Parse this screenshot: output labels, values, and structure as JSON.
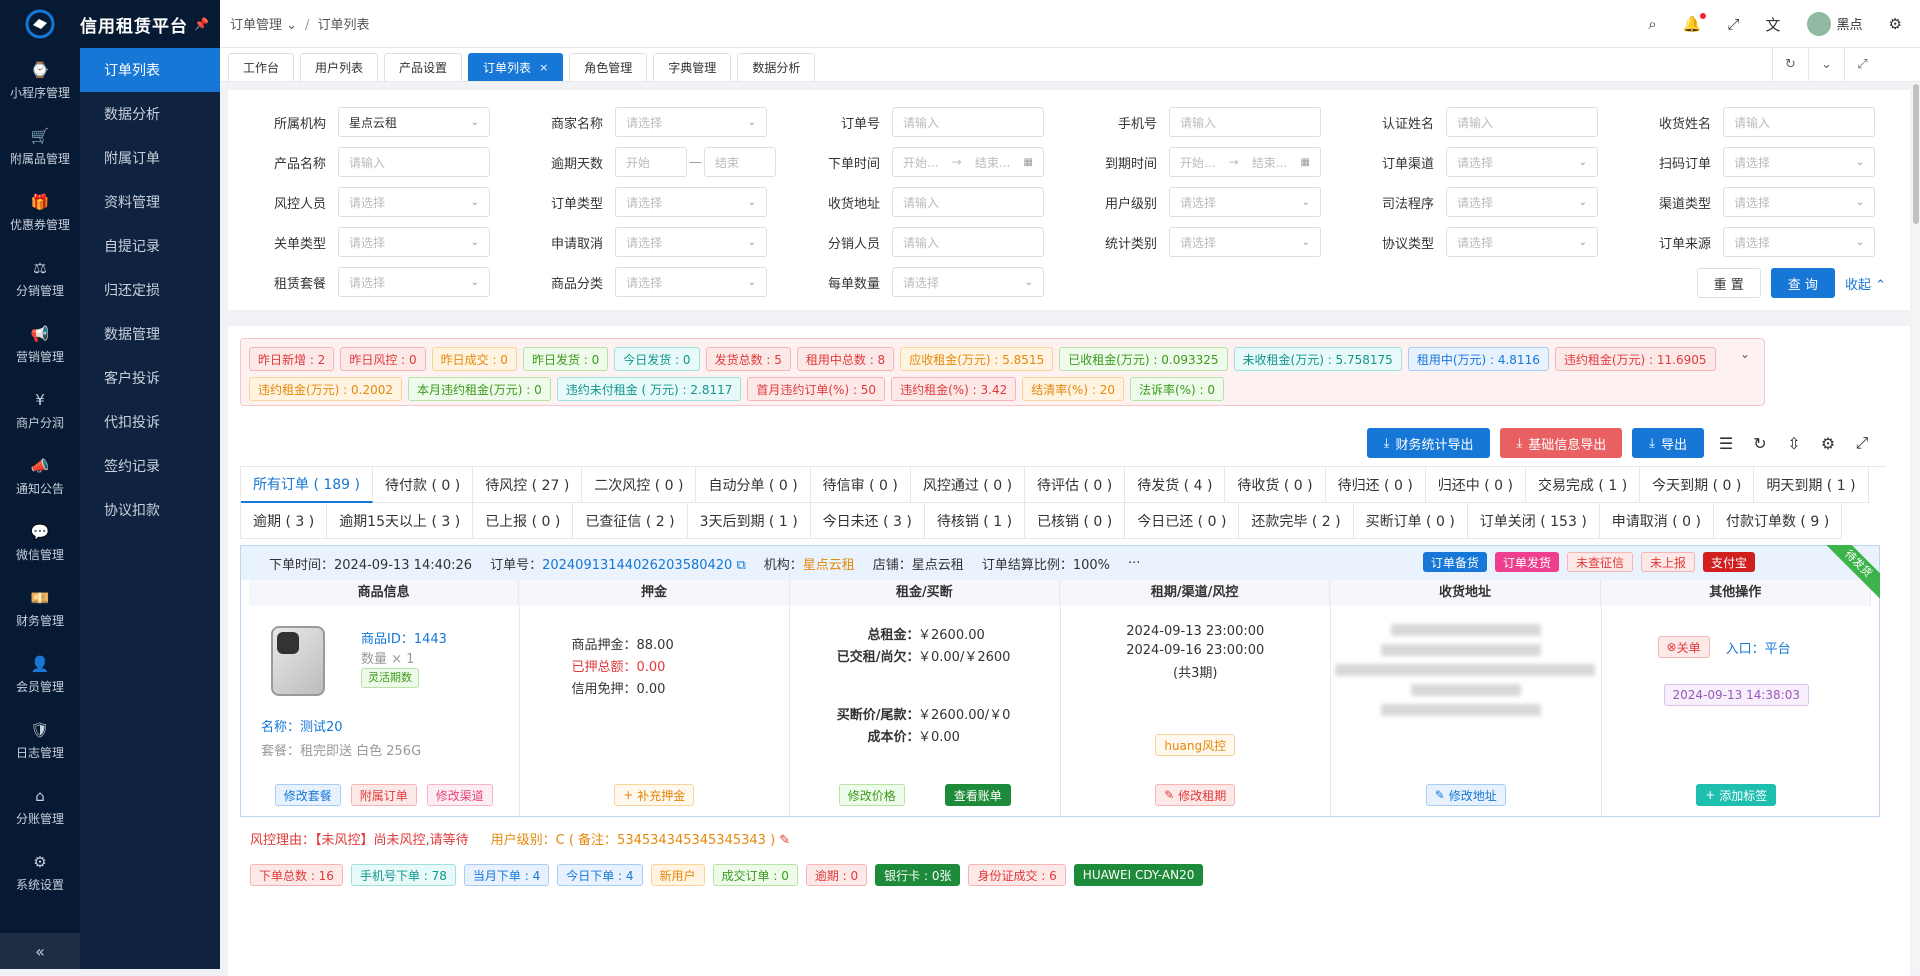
{
  "app": {
    "title": "信用租赁平台"
  },
  "rail": [
    {
      "label": "小程序管理",
      "icon": "watch-icon"
    },
    {
      "label": "附属品管理",
      "icon": "cart-icon"
    },
    {
      "label": "优惠券管理",
      "icon": "gift-icon"
    },
    {
      "label": "分销管理",
      "icon": "distribution-icon"
    },
    {
      "label": "营销管理",
      "icon": "megaphone-icon"
    },
    {
      "label": "商户分润",
      "icon": "yen-icon"
    },
    {
      "label": "通知公告",
      "icon": "notice-icon"
    },
    {
      "label": "微信管理",
      "icon": "chat-icon"
    },
    {
      "label": "财务管理",
      "icon": "finance-icon"
    },
    {
      "label": "会员管理",
      "icon": "member-icon"
    },
    {
      "label": "日志管理",
      "icon": "shield-icon"
    },
    {
      "label": "分账管理",
      "icon": "split-icon"
    },
    {
      "label": "系统设置",
      "icon": "gear-icon"
    }
  ],
  "submenu": [
    "订单列表",
    "数据分析",
    "附属订单",
    "资料管理",
    "自提记录",
    "归还定损",
    "数据管理",
    "客户投诉",
    "代扣投诉",
    "签约记录",
    "协议扣款"
  ],
  "breadcrumb": {
    "parent": "订单管理",
    "current": "订单列表"
  },
  "user": {
    "name": "黑点"
  },
  "tabs": [
    "工作台",
    "用户列表",
    "产品设置",
    "订单列表",
    "角色管理",
    "字典管理",
    "数据分析"
  ],
  "filters": {
    "row1": [
      {
        "label": "所属机构",
        "value": "星点云租",
        "type": "select"
      },
      {
        "label": "商家名称",
        "value": "请选择",
        "type": "select"
      },
      {
        "label": "订单号",
        "value": "请输入",
        "type": "input"
      },
      {
        "label": "手机号",
        "value": "请输入",
        "type": "input"
      },
      {
        "label": "认证姓名",
        "value": "请输入",
        "type": "input"
      },
      {
        "label": "收货姓名",
        "value": "请输入",
        "type": "input"
      }
    ],
    "row2_name": {
      "label": "产品名称",
      "value": "请输入"
    },
    "overdue": {
      "label": "逾期天数",
      "start": "开始",
      "end": "结束"
    },
    "order_time": {
      "label": "下单时间",
      "start": "开始...",
      "end": "结束..."
    },
    "due_time": {
      "label": "到期时间",
      "start": "开始...",
      "end": "结束..."
    },
    "row2_rest": [
      {
        "label": "订单渠道",
        "value": "请选择"
      },
      {
        "label": "扫码订单",
        "value": "请选择"
      }
    ],
    "row3": [
      {
        "label": "风控人员",
        "value": "请选择",
        "type": "select"
      },
      {
        "label": "订单类型",
        "value": "请选择",
        "type": "select"
      },
      {
        "label": "收货地址",
        "value": "请输入",
        "type": "input"
      },
      {
        "label": "用户级别",
        "value": "请选择",
        "type": "select"
      },
      {
        "label": "司法程序",
        "value": "请选择",
        "type": "select"
      },
      {
        "label": "渠道类型",
        "value": "请选择",
        "type": "select"
      }
    ],
    "row4": [
      {
        "label": "关单类型",
        "value": "请选择",
        "type": "select"
      },
      {
        "label": "申请取消",
        "value": "请选择",
        "type": "select"
      },
      {
        "label": "分销人员",
        "value": "请输入",
        "type": "input"
      },
      {
        "label": "统计类别",
        "value": "请选择",
        "type": "select"
      },
      {
        "label": "协议类型",
        "value": "请选择",
        "type": "select"
      },
      {
        "label": "订单来源",
        "value": "请选择",
        "type": "select"
      }
    ],
    "row5": [
      {
        "label": "租赁套餐",
        "value": "请选择",
        "type": "select"
      },
      {
        "label": "商品分类",
        "value": "请选择",
        "type": "select"
      },
      {
        "label": "每单数量",
        "value": "请选择",
        "type": "select"
      }
    ],
    "reset": "重 置",
    "query": "查 询",
    "collapse": "收起"
  },
  "stats": [
    {
      "text": "昨日新增 : 2",
      "c": "red"
    },
    {
      "text": "昨日风控 : 0",
      "c": "red"
    },
    {
      "text": "昨日成交 : 0",
      "c": "orange"
    },
    {
      "text": "昨日发货 : 0",
      "c": "green"
    },
    {
      "text": "今日发货 : 0",
      "c": "cyan"
    },
    {
      "text": "发货总数 : 5",
      "c": "red"
    },
    {
      "text": "租用中总数 : 8",
      "c": "red"
    },
    {
      "text": "应收租金(万元) : 5.8515",
      "c": "orange"
    },
    {
      "text": "已收租金(万元) : 0.093325",
      "c": "green"
    },
    {
      "text": "未收租金(万元) : 5.758175",
      "c": "cyan"
    },
    {
      "text": "租用中(万元) : 4.8116",
      "c": "blue"
    },
    {
      "text": "违约租金(万元) : 11.6905",
      "c": "red"
    },
    {
      "text": "违约租金(万元) : 0.2002",
      "c": "orange"
    },
    {
      "text": "本月违约租金(万元) : 0",
      "c": "green"
    },
    {
      "text": "违约未付租金 ( 万元) : 2.8117",
      "c": "cyan"
    },
    {
      "text": "首月违约订单(%) : 50",
      "c": "red"
    },
    {
      "text": "违约租金(%) : 3.42",
      "c": "red"
    },
    {
      "text": "结清率(%) : 20",
      "c": "orange"
    },
    {
      "text": "法诉率(%) : 0",
      "c": "green"
    }
  ],
  "actions": {
    "finance_export": "财务统计导出",
    "basic_export": "基础信息导出",
    "export": "导出"
  },
  "order_tabs": [
    "所有订单 ( 189 )",
    "待付款 ( 0 )",
    "待风控 ( 27 )",
    "二次风控 ( 0 )",
    "自动分单 ( 0 )",
    "待信审 ( 0 )",
    "风控通过 ( 0 )",
    "待评估 ( 0 )",
    "待发货 ( 4 )",
    "待收货 ( 0 )",
    "待归还 ( 0 )",
    "归还中 ( 0 )",
    "交易完成 ( 1 )",
    "今天到期 ( 0 )",
    "明天到期 ( 1 )",
    "逾期 ( 3 )",
    "逾期15天以上 ( 3 )",
    "已上报 ( 0 )",
    "已查征信 ( 2 )",
    "3天后到期 ( 1 )",
    "今日未还 ( 3 )",
    "待核销 ( 1 )",
    "已核销 ( 0 )",
    "今日已还 ( 0 )",
    "还款完毕 ( 2 )",
    "买断订单 ( 0 )",
    "订单关闭 ( 153 )",
    "申请取消 ( 0 )",
    "付款订单数 ( 9 )"
  ],
  "order": {
    "time": "下单时间：2024-09-13 14:40:26",
    "id_label": "订单号：",
    "id": "20240913144026203580420",
    "org_label": "机构：",
    "org": "星点云租",
    "store": "店铺：星点云租",
    "ratio": "订单结算比例：100%",
    "more": "···",
    "tags": [
      "订单备货",
      "订单发货",
      "未查征信",
      "未上报",
      "支付宝"
    ],
    "ribbon": "待发货",
    "cols": [
      "商品信息",
      "押金",
      "租金/买断",
      "租期/渠道/风控",
      "收货地址",
      "其他操作"
    ],
    "product": {
      "id": "商品ID：1443",
      "qty": "数量 × 1",
      "tag": "灵活期数",
      "name_label": "名称：",
      "name": "测试20",
      "package": "套餐：租完即送 白色 256G"
    },
    "product_btns": [
      "修改套餐",
      "附属订单",
      "修改渠道"
    ],
    "deposit": {
      "goods": "商品押金：88.00",
      "paid": "已押总额：0.00",
      "credit": "信用免押：0.00",
      "btn": "补充押金"
    },
    "rent": {
      "total_k": "总租金：",
      "total_v": "￥2600.00",
      "paid_k": "已交租/尚欠：",
      "paid_v": "￥0.00/￥2600",
      "buy_k": "买断价/尾款：",
      "buy_v": "￥2600.00/￥0",
      "cost_k": "成本价：",
      "cost_v": "￥0.00",
      "btn1": "修改价格",
      "btn2": "查看账单"
    },
    "period": {
      "start": "2024-09-13 23:00:00",
      "end": "2024-09-16 23:00:00",
      "count": "(共3期)",
      "risk": "huang风控",
      "btn": "修改租期"
    },
    "address": {
      "btn": "修改地址"
    },
    "other": {
      "close": "关单",
      "entry": "入口：平台",
      "time": "2024-09-13 14:38:03",
      "btn": "添加标签"
    }
  },
  "risk": {
    "reason": "风控理由：【未风控】尚未风控,请等待",
    "level": "用户级别：C ( 备注：534534345345345343 )"
  },
  "bottom_chips": [
    {
      "text": "下单总数 : 16",
      "c": "red"
    },
    {
      "text": "手机号下单 : 78",
      "c": "cyan"
    },
    {
      "text": "当月下单 : 4",
      "c": "blue"
    },
    {
      "text": "今日下单 : 4",
      "c": "blue"
    },
    {
      "text": "新用户",
      "c": "orange"
    },
    {
      "text": "成交订单 : 0",
      "c": "green"
    },
    {
      "text": "逾期 : 0",
      "c": "red"
    },
    {
      "text": "银行卡 : 0张",
      "c": "dgreen"
    },
    {
      "text": "身份证成交 : 6",
      "c": "red"
    },
    {
      "text": "HUAWEI CDY-AN20",
      "c": "dgreen"
    }
  ]
}
